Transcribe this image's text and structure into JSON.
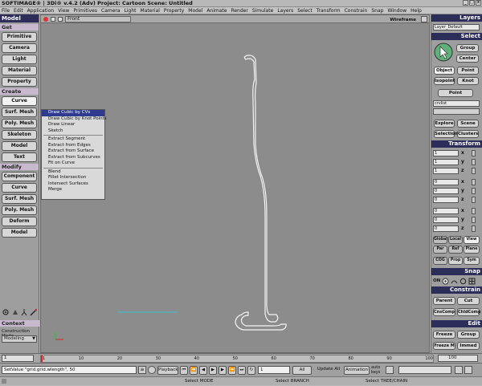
{
  "app": {
    "title": "SOFTIMAGE® | 3Di® v.4.2 (Adv) Project: Cartoon   Scene: Untitled",
    "window_controls": [
      "_",
      "□",
      "x"
    ]
  },
  "menubar": [
    "File",
    "Edit",
    "Application",
    "View",
    "Primitives",
    "Camera",
    "Light",
    "Material",
    "Property",
    "Model",
    "Animate",
    "Render",
    "Simulate",
    "Layers",
    "Select",
    "Transform",
    "Constrain",
    "Snap",
    "Window",
    "Help"
  ],
  "left_panel": {
    "title": "Model",
    "get_label": "Get",
    "get_buttons": [
      "Primitive",
      "Camera",
      "Light",
      "Material",
      "Property"
    ],
    "create_label": "Create",
    "create_buttons": [
      "Curve",
      "Surf. Mesh",
      "Poly. Mesh",
      "Skeleton",
      "Model",
      "Text"
    ],
    "modify_label": "Modify",
    "modify_buttons": [
      "Component",
      "Curve",
      "Surf. Mesh",
      "Poly. Mesh",
      "Deform",
      "Model"
    ],
    "context_label": "Context",
    "construction_mode_label": "Construction Mode",
    "construction_mode_value": "Modeling"
  },
  "viewport": {
    "camera": "Front",
    "display_mode": "Wireframe"
  },
  "curve_menu": [
    "Draw Cubic by CVs",
    "Draw Cubic by Knot Points",
    "Draw Linear",
    "Sketch",
    "---",
    "Extract Segment",
    "Extract from Edges",
    "Extract from Surface",
    "Extract from Subcurves",
    "Fit on Curve",
    "---",
    "Blend",
    "Fillet Intersection",
    "Intersect Surfaces",
    "Merge"
  ],
  "right_panel": {
    "layers_label": "Layers",
    "layer_value": "Layer_Default",
    "select_label": "Select",
    "group_label": "Group",
    "center_label": "Center",
    "object_label": "Object",
    "point_label": "Point",
    "isopoint_label": "Isopoint",
    "knot_label": "Knot",
    "point2_label": "Point",
    "select_field": "crvlist",
    "explore_label": "Explore",
    "scene_label": "Scene",
    "selection_label": "Selection",
    "clusters_label": "Clusters",
    "transform_label": "Transform",
    "scale_values": [
      "1",
      "1",
      "1"
    ],
    "rotate_values": [
      "0",
      "0",
      "0"
    ],
    "translate_values": [
      "0",
      "0",
      "0"
    ],
    "axes": [
      "x",
      "y",
      "z"
    ],
    "global_label": "Global",
    "local_label": "Local",
    "view_label": "View",
    "par_label": "Par",
    "ref_label": "Ref",
    "plane_label": "Plane",
    "cog_label": "COG",
    "prop_label": "Prop",
    "sym_label": "Sym",
    "snap_label": "Snap",
    "snap_on": "ON",
    "constrain_label": "Constrain",
    "parent_label": "Parent",
    "cut_label": "Cut",
    "cnscomp_label": "CnsComp",
    "childcomp_label": "ChldComp",
    "edit_label": "Edit",
    "freeze_label": "Freeze",
    "group2_label": "Group",
    "freezem_label": "Freeze M",
    "immed_label": "Immed"
  },
  "timeline": {
    "start": "1",
    "end": "100",
    "ticks": [
      "1",
      "10",
      "20",
      "30",
      "40",
      "50",
      "60",
      "70",
      "80",
      "90",
      "100"
    ],
    "current_frame": "1"
  },
  "command": {
    "script_text": "SetValue \"grid.grid.wlength\", 50",
    "playback_label": "Playback",
    "frame_field": "1",
    "frame_end_field": "100",
    "all_label": "All",
    "update_label": "Update All",
    "animation_label": "Animation",
    "auto_label": "auto",
    "keys_label": "keys"
  },
  "status": {
    "select_mode": "Select MODE",
    "select_branch": "Select BRANCH",
    "select_tree": "Select TREE/CHAIN"
  },
  "colors": {
    "header_bg": "#2d2d5a",
    "section_bg": "#c8b9cf",
    "viewport_bg": "#8c8c8c",
    "menu_highlight": "#2f3b8f",
    "grid_line": "#36c0c8",
    "curve": "#f4f4f4"
  }
}
